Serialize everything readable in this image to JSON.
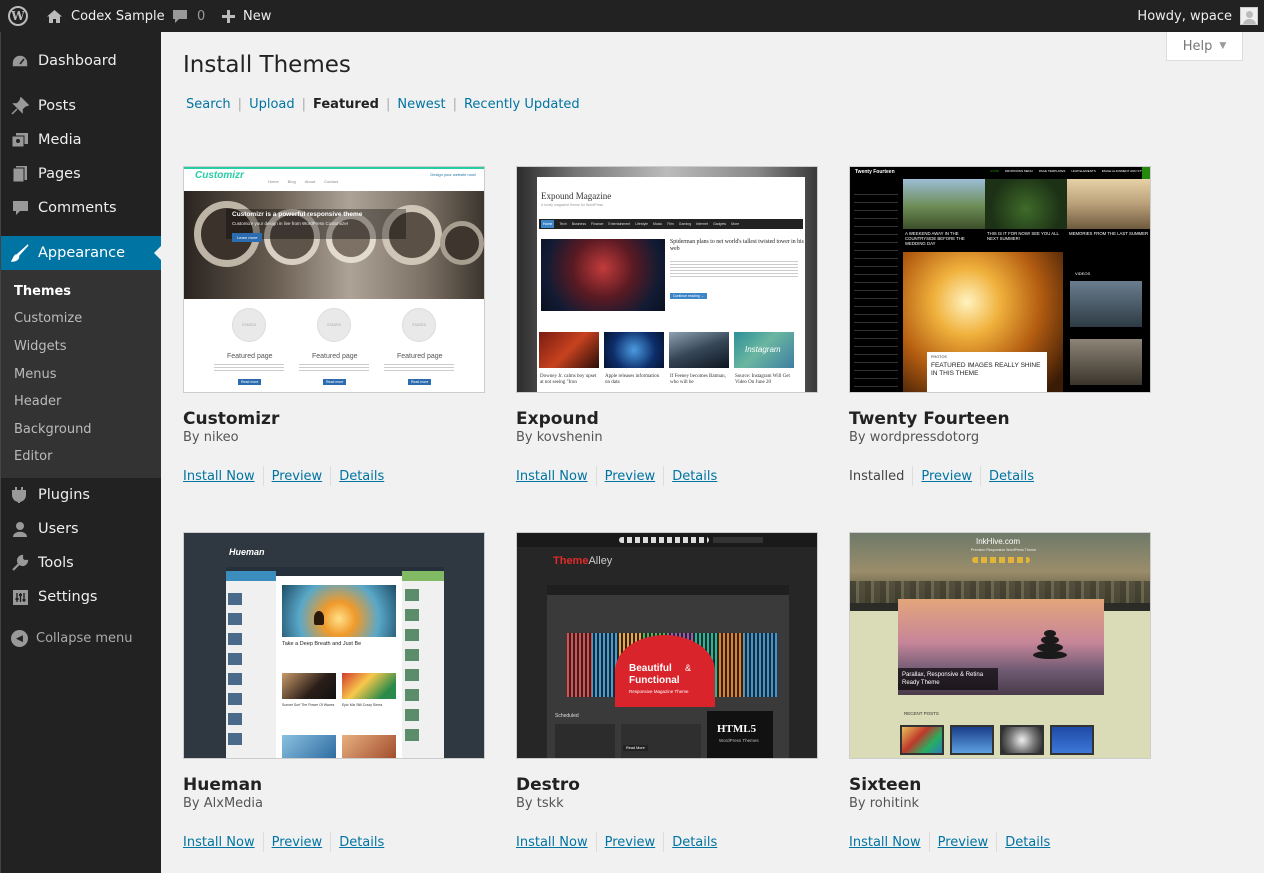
{
  "adminbar": {
    "site_name": "Codex Sample",
    "comment_count": "0",
    "new_label": "New",
    "howdy": "Howdy, wpace"
  },
  "sidebar": {
    "items": [
      {
        "label": "Dashboard",
        "icon": "dashboard-icon"
      },
      {
        "label": "Posts",
        "icon": "pin-icon"
      },
      {
        "label": "Media",
        "icon": "media-icon"
      },
      {
        "label": "Pages",
        "icon": "pages-icon"
      },
      {
        "label": "Comments",
        "icon": "comment-icon"
      },
      {
        "label": "Appearance",
        "icon": "brush-icon"
      },
      {
        "label": "Plugins",
        "icon": "plugin-icon"
      },
      {
        "label": "Users",
        "icon": "users-icon"
      },
      {
        "label": "Tools",
        "icon": "wrench-icon"
      },
      {
        "label": "Settings",
        "icon": "settings-icon"
      }
    ],
    "appearance_submenu": [
      "Themes",
      "Customize",
      "Widgets",
      "Menus",
      "Header",
      "Background",
      "Editor"
    ],
    "collapse_label": "Collapse menu"
  },
  "help_label": "Help",
  "page_title": "Install Themes",
  "filters": [
    "Search",
    "Upload",
    "Featured",
    "Newest",
    "Recently Updated"
  ],
  "current_filter": "Featured",
  "actions": {
    "install": "Install Now",
    "installed": "Installed",
    "preview": "Preview",
    "details": "Details"
  },
  "themes": [
    {
      "name": "Customizr",
      "author": "By nikeo",
      "installed": false,
      "shot": {
        "logo": "Customizr",
        "tagline": "Design your website now!",
        "nav": [
          "Home",
          "Blog",
          "About",
          "Contact"
        ],
        "headline": "Customizr is a powerful responsive theme",
        "sub": "Customize your design in live from WordPress Customizer",
        "button": "Learn more",
        "featured": [
          "Featured page",
          "Featured page",
          "Featured page"
        ],
        "circle_label": "STAGED",
        "read_more": "Read more"
      }
    },
    {
      "name": "Expound",
      "author": "By kovshenin",
      "installed": false,
      "shot": {
        "site_title": "Expound Magazine",
        "site_sub": "A lovely magazine theme for WordPress",
        "nav": [
          "Home",
          "Tech",
          "Business",
          "Finance",
          "Entertainment",
          "Lifestyle",
          "Music",
          "Film",
          "Gaming",
          "Internet",
          "Gadgets",
          "More"
        ],
        "headline": "Spiderman plans to net world's tallest twisted tower in his web",
        "button": "Continue reading →",
        "captions": [
          "Downey Jr. calms boy upset at not seeing \"Iron",
          "Apple releases information on data",
          "If Feeney becomes Batman, who will be",
          "Source: Instagram Will Get Video On June 20"
        ],
        "insta": "Instagram"
      }
    },
    {
      "name": "Twenty Fourteen",
      "author": "By wordpressdotorg",
      "installed": true,
      "shot": {
        "site_title": "Twenty Fourteen",
        "nav": [
          "HOME",
          "DROPDOWN MENU",
          "PAGE TEMPLATES",
          "HOW ELEMENTS",
          "IMAGE ALIGNMENT AND STYLES"
        ],
        "cap1": "A WEEKEND AWAY IN THE COUNTRYSIDE BEFORE THE WEDDING DAY",
        "cap2": "THIS IS IT FOR NOW! SEE YOU ALL NEXT SUMMER!",
        "cap3": "MEMORIES FROM THE LAST SUMMER",
        "feature_cat": "PHOTOS",
        "feature_title": "FEATURED IMAGES REALLY SHINE IN THIS THEME",
        "videos_label": "VIDEOS"
      }
    },
    {
      "name": "Hueman",
      "author": "By AlxMedia",
      "installed": false,
      "shot": {
        "logo": "Hueman",
        "post1": "Take a Deep Breath and Just Be",
        "post2": "Epic Mix Still Crazy Sierra",
        "post3": "Sunset Surf The Power Of Waves"
      }
    },
    {
      "name": "Destro",
      "author": "By tskk",
      "installed": false,
      "shot": {
        "logo_a": "Theme",
        "logo_b": "Alley",
        "badge1": "Beautiful",
        "badge_amp": "&",
        "badge2": "Functional",
        "badge_sub": "Responsive Magazine Theme",
        "scheduled": "Scheduled",
        "html5": "HTML5",
        "html5_sub": "WordPress Themes",
        "read_more": "Read More"
      }
    },
    {
      "name": "Sixteen",
      "author": "By rohitink",
      "installed": false,
      "shot": {
        "site_title": "InkHive.com",
        "site_sub": "Premium Responsive WordPress Theme",
        "caption": "Parallax, Responsive & Retina Ready Theme",
        "recent_posts": "RECENT POSTS"
      }
    }
  ],
  "colors": {
    "admin_dark": "#222222",
    "accent": "#0074a2",
    "link": "#0074a2",
    "background": "#f1f1f1"
  }
}
